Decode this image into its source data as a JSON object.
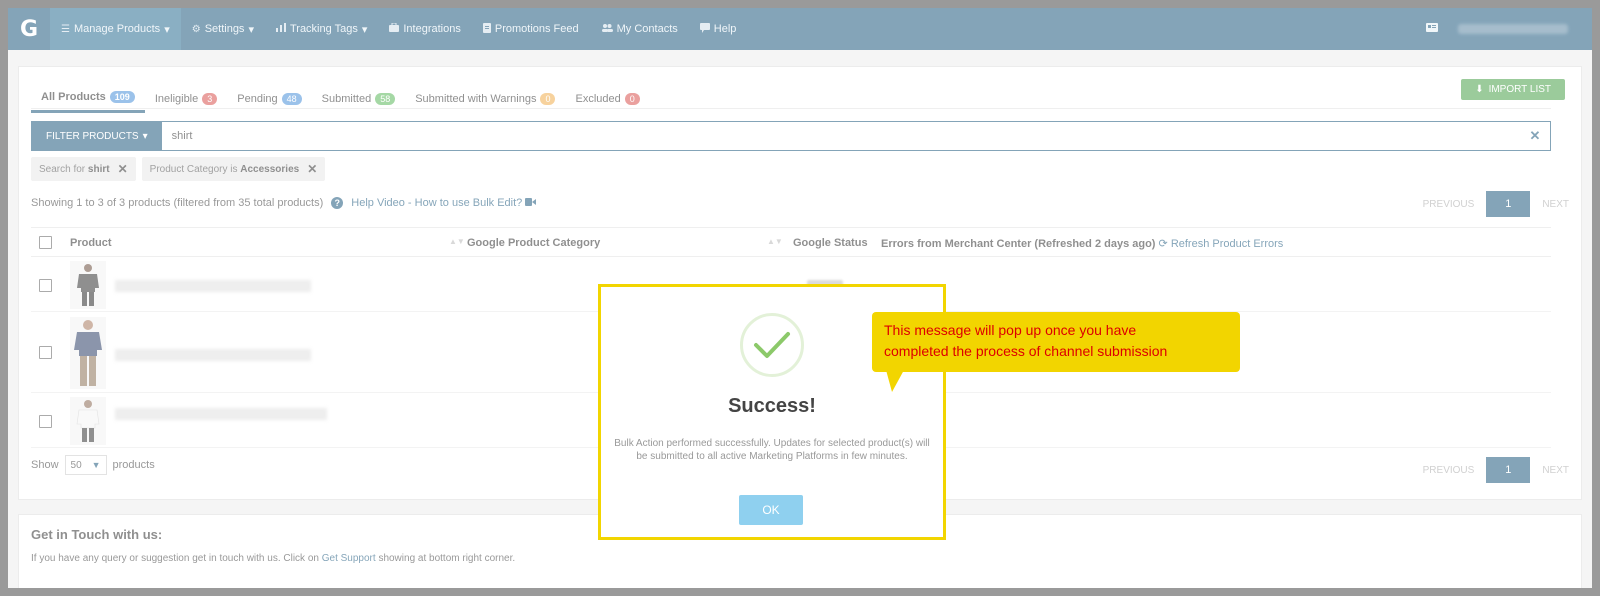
{
  "nav": {
    "logo": "G",
    "items": [
      {
        "label": "Manage Products",
        "icon": "list-icon",
        "caret": "▾"
      },
      {
        "label": "Settings",
        "icon": "gear-icon",
        "caret": "▾"
      },
      {
        "label": "Tracking Tags",
        "icon": "bar-chart-icon",
        "caret": "▾"
      },
      {
        "label": "Integrations",
        "icon": "briefcase-icon"
      },
      {
        "label": "Promotions Feed",
        "icon": "document-icon"
      },
      {
        "label": "My Contacts",
        "icon": "contacts-icon"
      },
      {
        "label": "Help",
        "icon": "chat-icon"
      }
    ]
  },
  "tabs": [
    {
      "label": "All Products",
      "count": "109",
      "color": "#4a90d9"
    },
    {
      "label": "Ineligible",
      "count": "3",
      "color": "#d9534f"
    },
    {
      "label": "Pending",
      "count": "48",
      "color": "#4a90d9"
    },
    {
      "label": "Submitted",
      "count": "58",
      "color": "#5cb85c"
    },
    {
      "label": "Submitted with Warnings",
      "count": "0",
      "color": "#f0ad4e"
    },
    {
      "label": "Excluded",
      "count": "0",
      "color": "#d9534f"
    }
  ],
  "import_button": "IMPORT LIST",
  "filter": {
    "button": "FILTER PRODUCTS",
    "value": "shirt"
  },
  "chips": [
    {
      "prefix": "Search for",
      "value": "shirt"
    },
    {
      "prefix": "Product Category is",
      "value": "Accessories"
    }
  ],
  "showing_text": "Showing 1 to 3 of 3 products (filtered from 35 total products)",
  "help_video": "Help Video - How to use Bulk Edit?",
  "pager": {
    "prev": "PREVIOUS",
    "page": "1",
    "next": "NEXT"
  },
  "table": {
    "headers": {
      "product": "Product",
      "category": "Google Product Category",
      "status": "Google Status",
      "errors": "Errors from Merchant Center (Refreshed 2 days ago)",
      "refresh": "Refresh Product Errors"
    }
  },
  "show": {
    "prefix": "Show",
    "value": "50",
    "suffix": "products"
  },
  "get_in_touch": {
    "title": "Get in Touch with us:",
    "text_before": "If you have any query or suggestion get in touch with us. Click on",
    "link": "Get Support",
    "text_after": "showing at bottom right corner."
  },
  "modal": {
    "title": "Success!",
    "message": "Bulk Action performed successfully. Updates for selected product(s) will be submitted to all active Marketing Platforms in few minutes.",
    "ok": "OK"
  },
  "callout": {
    "line1": "This message will pop up once you have",
    "line2": "completed the process of channel submission"
  },
  "colors": {
    "nav": "#1f5a7f",
    "accent": "#1f5a7f",
    "callout": "#f2d500",
    "callout_text": "#dd0000",
    "ok_button": "#8fd0ef"
  }
}
